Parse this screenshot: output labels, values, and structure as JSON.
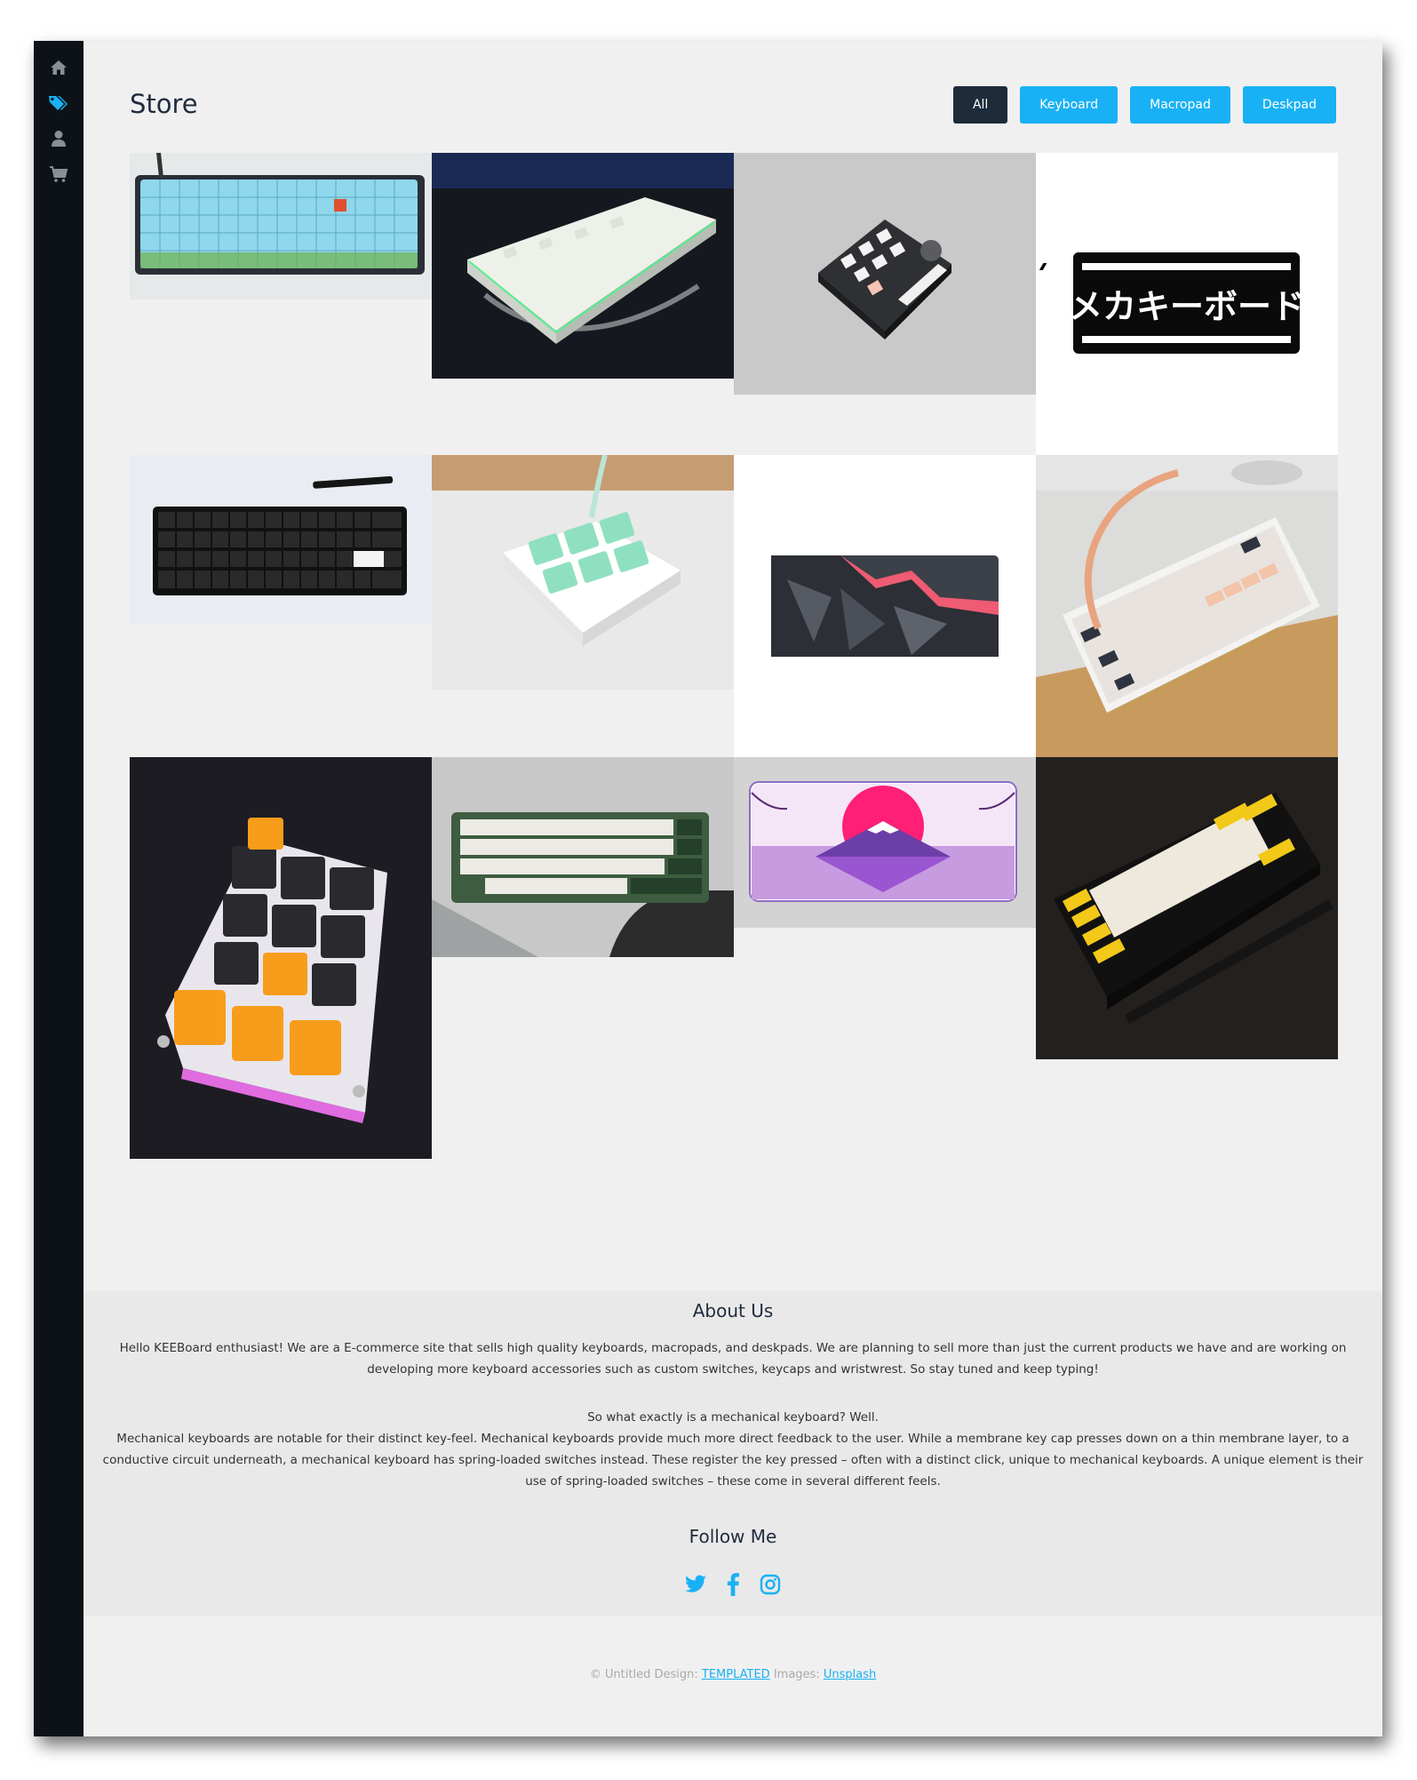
{
  "sidebar": {
    "items": [
      {
        "icon": "home-icon",
        "active": false
      },
      {
        "icon": "tags-icon",
        "active": true
      },
      {
        "icon": "user-icon",
        "active": false
      },
      {
        "icon": "cart-icon",
        "active": false
      }
    ]
  },
  "store": {
    "title": "Store",
    "filters": [
      {
        "label": "All",
        "active": true
      },
      {
        "label": "Keyboard",
        "active": false
      },
      {
        "label": "Macropad",
        "active": false
      },
      {
        "label": "Deskpad",
        "active": false
      }
    ],
    "products": [
      {
        "name": "product-keyboard-mario"
      },
      {
        "name": "product-keyboard-white-rgb"
      },
      {
        "name": "product-macropad-slider"
      },
      {
        "name": "product-deskpad-mechakeyboard"
      },
      {
        "name": "product-keyboard-black-60"
      },
      {
        "name": "product-macropad-mint"
      },
      {
        "name": "product-deskpad-polygon"
      },
      {
        "name": "product-keyboard-peach-cable"
      },
      {
        "name": "product-macropad-orange-arrows"
      },
      {
        "name": "product-keyboard-green"
      },
      {
        "name": "product-deskpad-fuji"
      },
      {
        "name": "product-keyboard-yellow-black"
      }
    ],
    "deskpad_text": "メカキーボード"
  },
  "about": {
    "title": "About Us",
    "paragraph1": "Hello KEEBoard enthusiast! We are a E-commerce site that sells high quality keyboards, macropads, and deskpads. We are planning to sell more than just the current products we have and are working on developing more keyboard accessories such as custom switches, keycaps and wristwrest. So stay tuned and keep typing!",
    "question": "So what exactly is a mechanical keyboard? Well.",
    "paragraph2": "Mechanical keyboards are notable for their distinct key-feel. Mechanical keyboards provide much more direct feedback to the user. While a membrane key cap presses down on a thin membrane layer, to a conductive circuit underneath, a mechanical keyboard has spring-loaded switches instead. These register the key pressed – often with a distinct click, unique to mechanical keyboards. A unique element is their use of spring-loaded switches – these come in several different feels.",
    "follow_title": "Follow Me",
    "socials": [
      "twitter-icon",
      "facebook-icon",
      "instagram-icon"
    ]
  },
  "footer": {
    "copyright": "© Untitled Design:",
    "templated_link": "TEMPLATED",
    "images_label": "Images:",
    "unsplash_link": "Unsplash"
  },
  "colors": {
    "accent": "#19b1f5",
    "dark": "#1d2b3a",
    "sidebar": "#0d1218",
    "sidebar_icon": "#8a8f96"
  }
}
